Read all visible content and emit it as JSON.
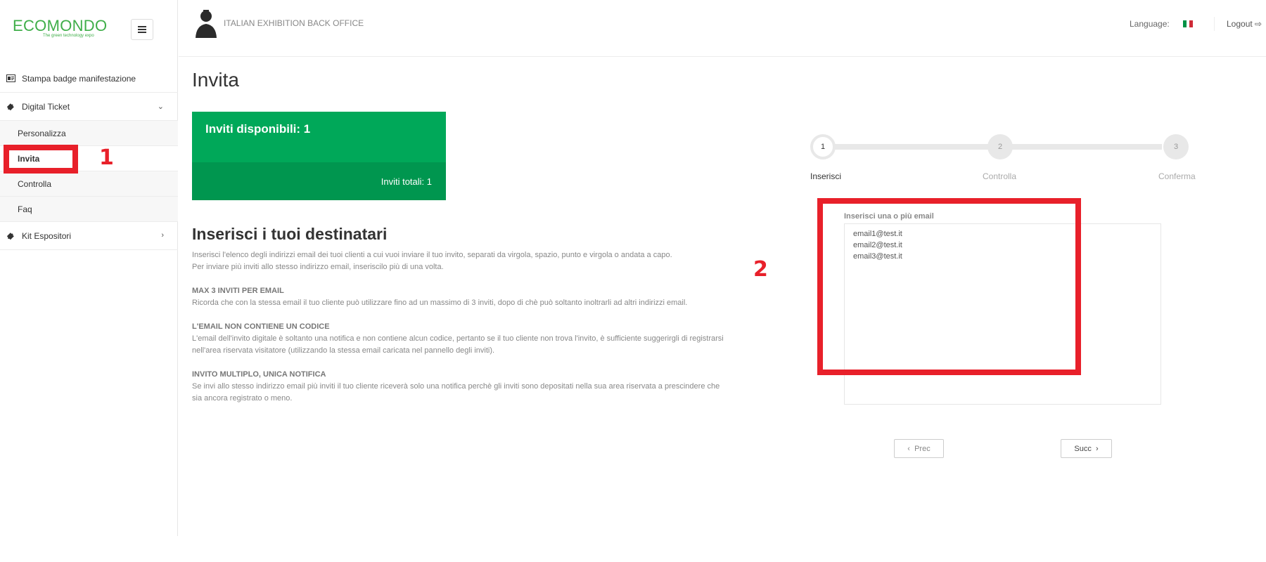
{
  "brand": {
    "name": "ECOMONDO",
    "tagline": "The green technology expo"
  },
  "header": {
    "app_title": "ITALIAN EXHIBITION BACK OFFICE",
    "language_label": "Language:",
    "flag_colors": [
      "#009246",
      "#ffffff",
      "#ce2b37"
    ],
    "logout_label": "Logout"
  },
  "sidebar": {
    "items": [
      {
        "label": "Stampa badge manifestazione",
        "icon": "id-card-icon"
      },
      {
        "label": "Digital Ticket",
        "icon": "ticket-icon",
        "expanded": true,
        "children": [
          {
            "label": "Personalizza"
          },
          {
            "label": "Invita",
            "active": true
          },
          {
            "label": "Controlla"
          },
          {
            "label": "Faq"
          }
        ]
      },
      {
        "label": "Kit Espositori",
        "icon": "ticket-icon",
        "expanded": false
      }
    ]
  },
  "main": {
    "page_title": "Invita",
    "invites": {
      "available": "Inviti disponibili: 1",
      "total": "Inviti totali: 1",
      "color": "#00a859"
    },
    "section_title": "Inserisci i tuoi destinatari",
    "intro_1": "Inserisci l'elenco degli indirizzi email dei tuoi clienti a cui vuoi inviare il tuo invito, separati da virgola, spazio, punto e virgola o andata a capo.",
    "intro_2": "Per inviare più inviti allo stesso indirizzo email, inseriscilo più di una volta.",
    "notes": [
      {
        "title": "MAX 3 INVITI PER EMAIL",
        "text": "Ricorda che con la stessa email il tuo cliente può utilizzare fino ad un massimo di 3 inviti, dopo di chè può soltanto inoltrarli ad altri indirizzi email."
      },
      {
        "title": "L'EMAIL NON CONTIENE UN CODICE",
        "text": "L'email dell'invito digitale è soltanto una notifica e non contiene alcun codice, pertanto se il tuo cliente non trova l'invito, è sufficiente suggerirgli di registrarsi nell'area riservata visitatore (utilizzando la stessa email caricata nel pannello degli inviti)."
      },
      {
        "title": "INVITO MULTIPLO, UNICA NOTIFICA",
        "text": "Se invi allo stesso indirizzo email più inviti il tuo cliente riceverà solo una notifica perchè gli inviti sono depositati nella sua area riservata a prescindere che sia ancora registrato o meno."
      }
    ],
    "stepper": {
      "current": 1,
      "steps": [
        {
          "number": "1",
          "label": "Inserisci"
        },
        {
          "number": "2",
          "label": "Controlla"
        },
        {
          "number": "3",
          "label": "Conferma"
        }
      ]
    },
    "email_field": {
      "label": "Inserisci una o più email",
      "value": "email1@test.it\nemail2@test.it\nemail3@test.it"
    },
    "buttons": {
      "prev": "Prec",
      "next": "Succ"
    }
  },
  "annotations": {
    "mark_1": "1",
    "mark_2": "2",
    "color": "#e8202a"
  }
}
